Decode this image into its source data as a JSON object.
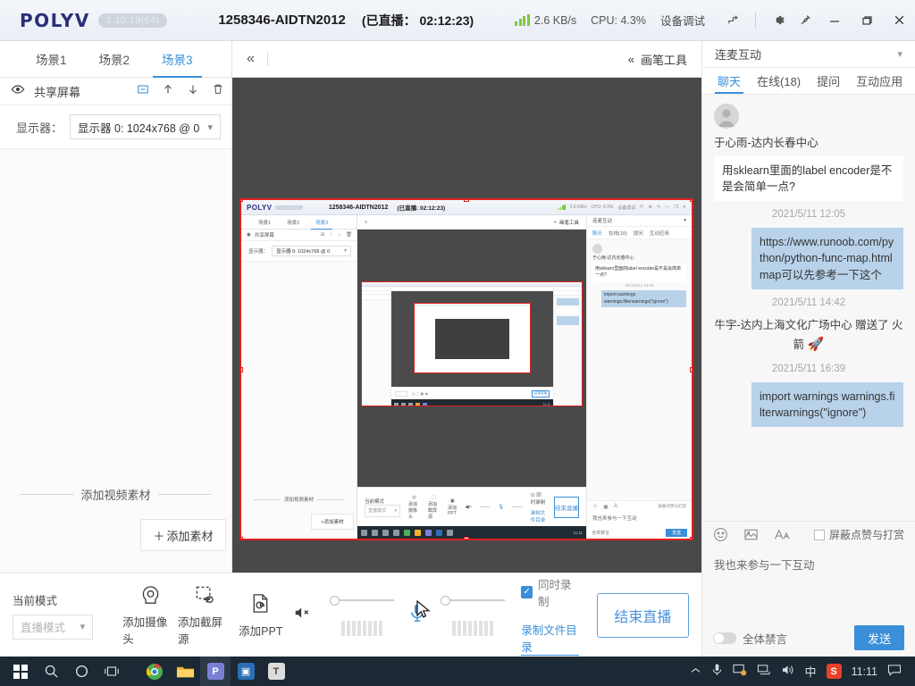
{
  "titlebar": {
    "logo": "POLYV",
    "version": "2.10.19(64)",
    "stream_id": "1258346-AIDTN2012",
    "stream_time": "(已直播： 02:12:23)",
    "network_speed": "2.6 KB/s",
    "cpu": "CPU: 4.3%",
    "device_debug": "设备调试",
    "icons": {
      "signal": "signal-bars-icon",
      "share": "share-icon",
      "settings": "gear-icon",
      "pin": "pin-icon",
      "minimize": "minimize-icon",
      "maximize": "maximize-icon",
      "close": "close-icon"
    },
    "accent_color": "#2b2f77"
  },
  "sidebar": {
    "scenes": [
      {
        "label": "场景1",
        "active": false
      },
      {
        "label": "场景2",
        "active": false
      },
      {
        "label": "场景3",
        "active": true
      }
    ],
    "layer": {
      "name": "共享屏幕",
      "eye_icon": "eye-icon",
      "actions": [
        "minus-box-icon",
        "arrow-up-icon",
        "arrow-down-icon",
        "trash-icon"
      ]
    },
    "monitor": {
      "label": "显示器：",
      "value": "显示器 0: 1024x768 @ 0"
    },
    "divider_label": "添加视频素材",
    "add_material_button": "添加素材"
  },
  "preview": {
    "collapse_icon": "chevron-double-left-icon",
    "pen_tool_label": "画笔工具",
    "pen_tool_icon": "chevron-double-left-icon",
    "frame_color": "#e02020"
  },
  "mini": {
    "logo": "POLYV",
    "version": "2.10.19(64)",
    "stream_id": "1258346-AIDTN2012",
    "stream_time": "(已直播: 02:12:23)",
    "network_speed": "2.6 KB/s",
    "cpu": "CPU: 4.3%",
    "device_debug": "设备调试",
    "scenes": [
      "场景1",
      "场景2",
      "场景3"
    ],
    "layer_name": "共享屏幕",
    "monitor_label": "显示器：",
    "monitor_value": "显示器 0: 1024x768 @ 0",
    "divider_label": "添加视频素材",
    "add_material": "+添加素材",
    "pen_tool_label": "画笔工具",
    "chat_title": "连麦互动",
    "chat_tabs": [
      "聊天",
      "在线(18)",
      "提问",
      "互动应用"
    ],
    "chat_user": "于心雨-达内长春中心",
    "msg1": "用sklearn里面的label encoder是不是会简单一点?",
    "ts1": "2021/5/11 12:05",
    "msg_code": "import warnings warnings.filterwarnings(\"ignore\")",
    "block_label": "屏蔽点赞与打赏",
    "input_placeholder": "我也来参与一下互动",
    "mute_all": "全体禁言",
    "send": "发送",
    "mode_label": "当前模式",
    "mode_value": "直播模式",
    "tool_camera": "添加摄像头",
    "tool_capture": "添加截屏源",
    "tool_ppt": "添加PPT",
    "rec_label": "同时录制",
    "rec_link": "录制文件目录",
    "end_button": "结束直播"
  },
  "chat": {
    "title": "连麦互动",
    "tabs": [
      {
        "label": "聊天",
        "active": true
      },
      {
        "label": "在线(18)",
        "active": false
      },
      {
        "label": "提问",
        "active": false
      },
      {
        "label": "互动应用",
        "active": false
      }
    ],
    "user_name": "于心雨-达内长春中心",
    "messages": [
      {
        "type": "left",
        "text": "用sklearn里面的label encoder是不是会简单一点?"
      },
      {
        "type": "time",
        "text": "2021/5/11 12:05"
      },
      {
        "type": "right",
        "text": "https://www.runoob.com/python/python-func-map.html map可以先参考一下这个"
      },
      {
        "type": "time",
        "text": "2021/5/11 14:42"
      },
      {
        "type": "gift",
        "text": "牛宇-达内上海文化广场中心 赠送了 火箭",
        "emoji": "🚀"
      },
      {
        "type": "time",
        "text": "2021/5/11 16:39"
      },
      {
        "type": "right",
        "text": "import warnings warnings.filterwarnings(\"ignore\")"
      }
    ],
    "tools": {
      "emoji_icon": "smiley-icon",
      "image_icon": "image-icon",
      "font_icon": "font-size-icon",
      "block_label": "屏蔽点赞与打赏"
    },
    "input_placeholder": "我也来参与一下互动",
    "mute_all_label": "全体禁言",
    "send_label": "发送",
    "accent_color": "#3a8fd8",
    "bubble_color": "#b8d2ea"
  },
  "bottombar": {
    "mode_label": "当前模式",
    "mode_value": "直播模式",
    "tools": [
      {
        "label": "添加摄像头",
        "icon": "camera-icon"
      },
      {
        "label": "添加截屏源",
        "icon": "screen-capture-icon"
      },
      {
        "label": "添加PPT",
        "icon": "ppt-icon"
      }
    ],
    "speaker_icon": "speaker-muted-icon",
    "mic_icon": "microphone-icon",
    "record_checkbox_label": "同时录制",
    "record_checked": true,
    "record_link": "录制文件目录",
    "end_button": "结束直播"
  },
  "taskbar": {
    "start_icon": "windows-start-icon",
    "search_icon": "search-icon",
    "cortana_icon": "cortana-circle-icon",
    "taskview_icon": "task-view-icon",
    "apps": [
      {
        "name": "chrome-icon",
        "color": "#4caf50",
        "glyph": "◉"
      },
      {
        "name": "file-explorer-icon",
        "color": "#f0b429",
        "glyph": "▤"
      },
      {
        "name": "polyv-icon",
        "color": "#7b7fd4",
        "glyph": "P"
      },
      {
        "name": "app-icon",
        "color": "#2a6fb5",
        "glyph": "▣"
      },
      {
        "name": "text-app-icon",
        "color": "#c9c9c9",
        "glyph": "T"
      }
    ],
    "tray": {
      "chevron": "chevron-up-icon",
      "mic": "microphone-icon",
      "screen_share": "screen-share-icon",
      "network": "network-icon",
      "volume": "volume-icon",
      "ime": "中",
      "sogou": "S",
      "clock": "11:11",
      "notification": "notification-icon"
    }
  }
}
